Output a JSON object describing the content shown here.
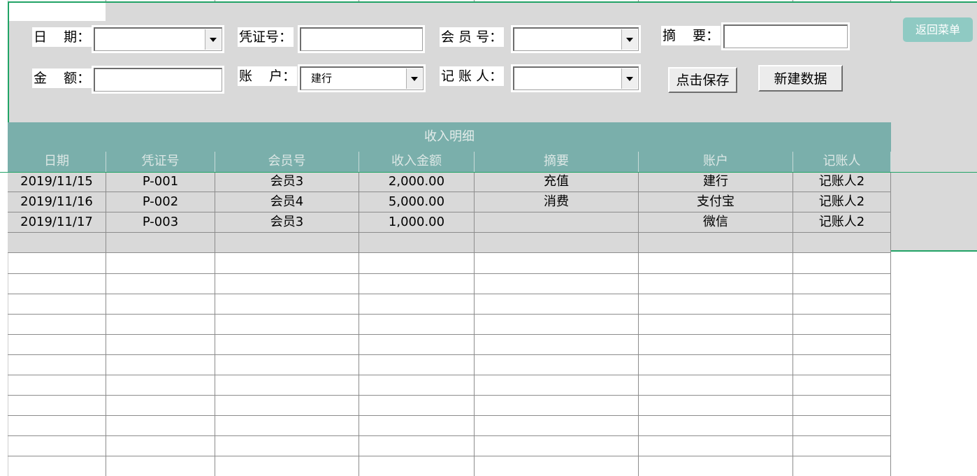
{
  "form": {
    "date_label": "日    期：",
    "voucher_label": "凭证号：",
    "member_label": "会 员 号：",
    "summary_label": "摘    要：",
    "amount_label": "金    额：",
    "account_label": "账    户：",
    "bookkeeper_label": "记 账 人：",
    "date_value": "",
    "voucher_value": "",
    "member_value": "",
    "summary_value": "",
    "amount_value": "",
    "account_value": "建行",
    "bookkeeper_value": ""
  },
  "buttons": {
    "save": "点击保存",
    "new": "新建数据",
    "back_menu": "返回菜单"
  },
  "table": {
    "title": "收入明细",
    "columns": [
      "日期",
      "凭证号",
      "会员号",
      "收入金额",
      "摘要",
      "账户",
      "记账人"
    ],
    "rows": [
      [
        "2019/11/15",
        "P-001",
        "会员3",
        "2,000.00",
        "充值",
        "建行",
        "记账人2"
      ],
      [
        "2019/11/16",
        "P-002",
        "会员4",
        "5,000.00",
        "消费",
        "支付宝",
        "记账人2"
      ],
      [
        "2019/11/17",
        "P-003",
        "会员3",
        "1,000.00",
        "",
        "微信",
        "记账人2"
      ],
      [
        "",
        "",
        "",
        "",
        "",
        "",
        ""
      ]
    ]
  },
  "colors": {
    "panel": "#d9d9d9",
    "header": "#7aafab",
    "accent_border": "#21a366",
    "menu_button": "#8fcac3"
  }
}
